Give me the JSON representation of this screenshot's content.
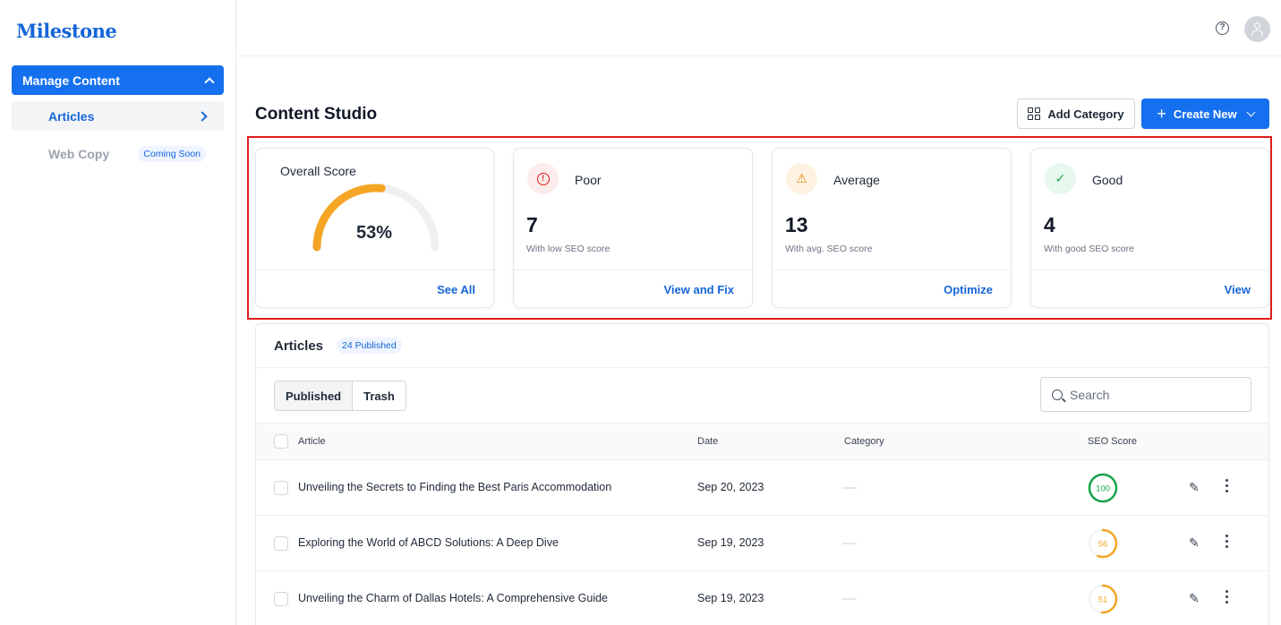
{
  "app": {
    "logo": "Milestone"
  },
  "sidebar": {
    "group_label": "Manage Content",
    "items": [
      {
        "label": "Articles",
        "active": true
      },
      {
        "label": "Web Copy",
        "badge": "Coming Soon"
      }
    ]
  },
  "header": {
    "title": "Content Studio",
    "add_category_label": "Add Category",
    "create_new_label": "Create New"
  },
  "summary": {
    "overall": {
      "title": "Overall Score",
      "value": "53%",
      "fraction": 0.53,
      "action": "See All"
    },
    "poor": {
      "title": "Poor",
      "count": "7",
      "subtitle": "With low SEO score",
      "action": "View and Fix"
    },
    "average": {
      "title": "Average",
      "count": "13",
      "subtitle": "With avg. SEO score",
      "action": "Optimize"
    },
    "good": {
      "title": "Good",
      "count": "4",
      "subtitle": "With good SEO score",
      "action": "View"
    }
  },
  "articles": {
    "title": "Articles",
    "badge": "24 Published",
    "tabs": [
      "Published",
      "Trash"
    ],
    "search_placeholder": "Search",
    "columns": [
      "Article",
      "Date",
      "Category",
      "SEO Score"
    ],
    "rows": [
      {
        "title": "Unveiling the Secrets to Finding the Best Paris Accommodation",
        "date": "Sep 20, 2023",
        "score": "100",
        "score_value": 100,
        "color": "#16a34a"
      },
      {
        "title": "Exploring the World of ABCD Solutions: A Deep Dive",
        "date": "Sep 19, 2023",
        "score": "56",
        "score_value": 56,
        "color": "#f5a524"
      },
      {
        "title": "Unveiling the Charm of Dallas Hotels: A Comprehensive Guide",
        "date": "Sep 19, 2023",
        "score": "51",
        "score_value": 51,
        "color": "#f5a524"
      }
    ]
  },
  "colors": {
    "accent": "#1570ef",
    "highlight": "#e11d1d",
    "gauge": "#f5a524"
  }
}
